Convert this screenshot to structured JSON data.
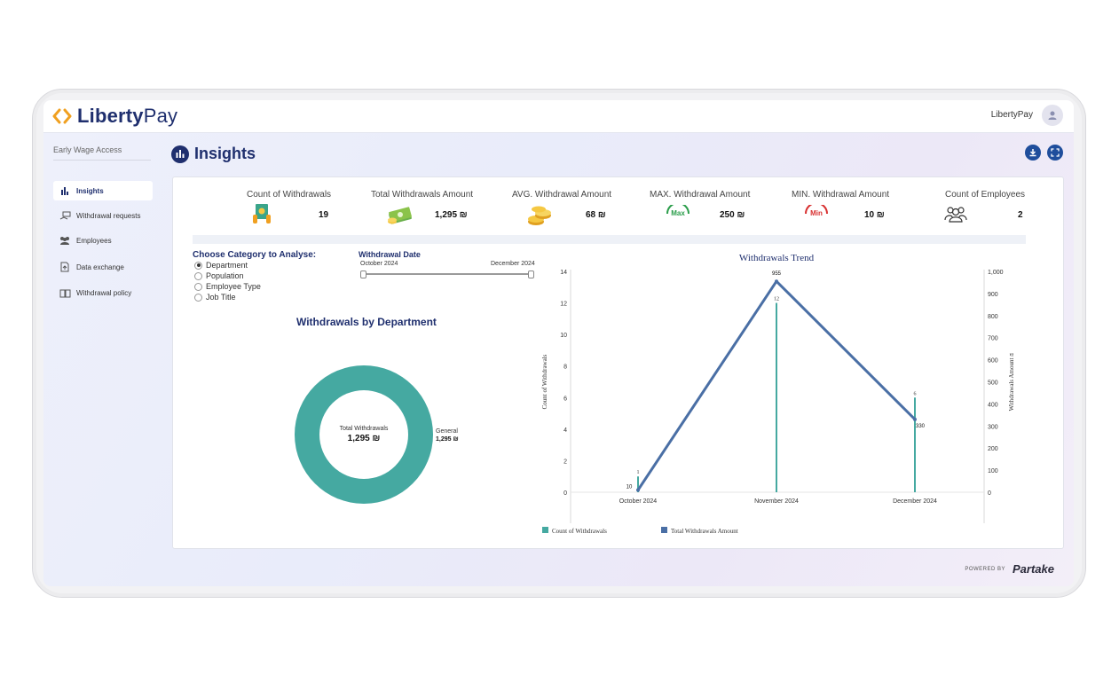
{
  "app": {
    "brand_a": "Liberty",
    "brand_b": "Pay",
    "user_name": "LibertyPay",
    "powered_by": "POWERED BY",
    "powered_brand": "Partake"
  },
  "sidebar": {
    "title": "Early Wage Access",
    "items": [
      {
        "label": "Insights",
        "icon": "bar-chart-icon"
      },
      {
        "label": "Withdrawal requests",
        "icon": "hand-money-icon"
      },
      {
        "label": "Employees",
        "icon": "people-icon"
      },
      {
        "label": "Data exchange",
        "icon": "file-upload-icon"
      },
      {
        "label": "Withdrawal policy",
        "icon": "book-icon"
      }
    ]
  },
  "page": {
    "title": "Insights"
  },
  "kpis": [
    {
      "label": "Count of  Withdrawals",
      "value": "19",
      "icon": "money-hand-icon"
    },
    {
      "label": "Total Withdrawals Amount",
      "value": "1,295 ₪",
      "icon": "cash-stack-icon"
    },
    {
      "label": "AVG. Withdrawal Amount",
      "value": "68 ₪",
      "icon": "coins-icon"
    },
    {
      "label": "MAX.  Withdrawal Amount",
      "value": "250 ₪",
      "icon": "max-gauge-icon",
      "badge": "Max"
    },
    {
      "label": "MIN.  Withdrawal Amount",
      "value": "10 ₪",
      "icon": "min-gauge-icon",
      "badge": "Min"
    },
    {
      "label": "Count of  Employees",
      "value": "2",
      "icon": "employees-icon"
    }
  ],
  "filters": {
    "category_title": "Choose Category to Analyse:",
    "options": [
      "Department",
      "Population",
      "Employee Type",
      "Job Title"
    ],
    "selected": "Department",
    "date_title": "Withdrawal Date",
    "date_from": "October 2024",
    "date_to": "December 2024"
  },
  "donut": {
    "title": "Withdrawals by Department",
    "center_label": "Total Withdrawals",
    "center_value": "1,295 ₪",
    "segment_name": "General",
    "segment_value": "1,295 ₪",
    "color": "#45a9a1"
  },
  "chart_data": {
    "type": "line",
    "title": "Withdrawals Trend",
    "categories": [
      "October 2024",
      "November 2024",
      "December 2024"
    ],
    "y_left_label": "Count of Withdrawals",
    "y_right_label": "Withdrawals Amount ₪",
    "y_left_ticks": [
      "0",
      "2",
      "4",
      "6",
      "8",
      "10",
      "12",
      "14"
    ],
    "y_right_ticks": [
      "0",
      "100",
      "200",
      "300",
      "400",
      "500",
      "600",
      "700",
      "800",
      "900",
      "1,000"
    ],
    "ylim_left": [
      0,
      14
    ],
    "ylim_right": [
      0,
      1000
    ],
    "series": [
      {
        "name": "Count of Withdrawals",
        "type": "bar",
        "axis": "left",
        "color": "#45a9a1",
        "values": [
          1,
          12,
          6
        ],
        "labels": [
          "1",
          "12",
          "6"
        ]
      },
      {
        "name": "Total Withdrawals Amount",
        "type": "line",
        "axis": "right",
        "color": "#4a6fa5",
        "values": [
          10,
          955,
          330
        ],
        "labels": [
          "10",
          "955",
          "330"
        ]
      }
    ]
  }
}
